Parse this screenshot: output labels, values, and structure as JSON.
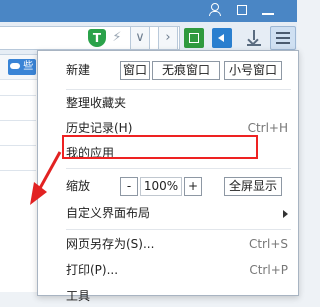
{
  "menu": {
    "new_label": "新建",
    "new_buttons": [
      "窗口",
      "无痕窗口",
      "小号窗口"
    ],
    "organize_label": "整理收藏夹",
    "history_label": "历史记录(H)",
    "history_shortcut": "Ctrl+H",
    "my_apps_label": "我的应用",
    "zoom_label": "缩放",
    "zoom_minus": "-",
    "zoom_value": "100%",
    "zoom_plus": "+",
    "fullscreen_label": "全屏显示",
    "customize_label": "自定义界面布局",
    "save_as_label": "网页另存为(S)...",
    "save_as_shortcut": "Ctrl+S",
    "print_label": "打印(P)...",
    "print_shortcut": "Ctrl+P",
    "tools_label": "工具"
  },
  "favbar": {
    "first_item": "些"
  },
  "toolbar": {
    "shield_letter": "T",
    "bolt_glyph": "⚡",
    "dropdown_glyph": "∨",
    "next_glyph": "›"
  },
  "colors": {
    "topbar": "#4a86c5",
    "highlight": "#e22222",
    "annotation_arrow": "#e22222"
  }
}
